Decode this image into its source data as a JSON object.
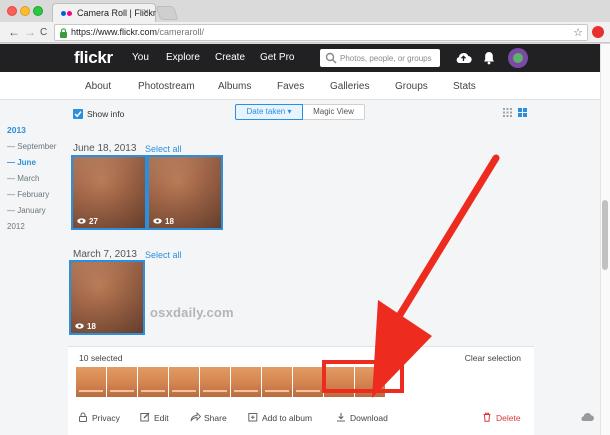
{
  "browser": {
    "tab_title": "Camera Roll | Flickr",
    "tab_close": "×",
    "back": "←",
    "forward": "→",
    "reload": "C",
    "url_host": "https://www.flickr.com",
    "url_path": "/cameraroll/",
    "star": "☆"
  },
  "topnav": {
    "logo": "flickr",
    "items": [
      "You",
      "Explore",
      "Create",
      "Get Pro"
    ],
    "search_placeholder": "Photos, people, or groups"
  },
  "subnav": {
    "items": [
      "About",
      "Photostream",
      "Albums",
      "Faves",
      "Galleries",
      "Groups",
      "Stats"
    ]
  },
  "timeline": {
    "year_2013": "2013",
    "months": [
      "— September",
      "— June",
      "— March",
      "— February",
      "— January"
    ],
    "year_2012": "2012"
  },
  "controls": {
    "show_info": "Show info",
    "date_taken": "Date taken ▾",
    "magic_view": "Magic View"
  },
  "groups": [
    {
      "date": "June 18, 2013",
      "select_all": "Select all",
      "photos": [
        {
          "views": "27"
        },
        {
          "views": "18"
        }
      ]
    },
    {
      "date": "March 7, 2013",
      "select_all": "Select all",
      "photos": [
        {
          "views": "18"
        }
      ]
    }
  ],
  "selection_bar": {
    "count": "10 selected",
    "clear": "Clear selection",
    "actions": {
      "privacy": "Privacy",
      "edit": "Edit",
      "share": "Share",
      "add_to_album": "Add to album",
      "download": "Download",
      "delete": "Delete"
    }
  },
  "watermark": "osxdaily.com",
  "colors": {
    "accent": "#2c8fdd",
    "annotation": "#ee2b1f",
    "nav_bg": "#212124"
  }
}
